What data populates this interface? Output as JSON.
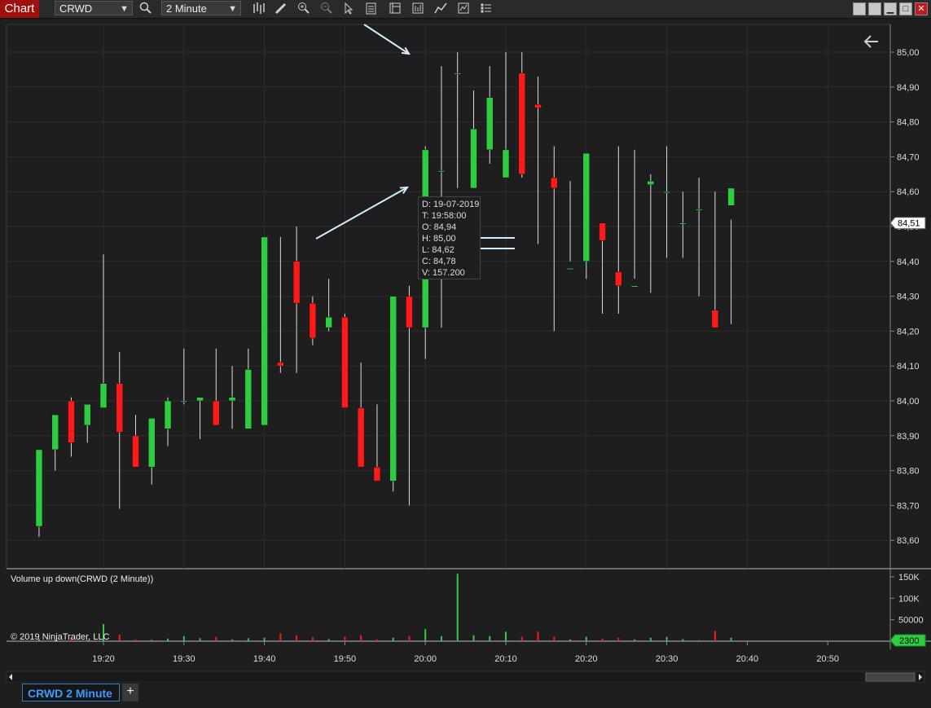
{
  "toolbar": {
    "chart_tab": "Chart",
    "instrument": "CRWD",
    "interval": "2 Minute",
    "icons": [
      "search-icon",
      "bar-type-icon",
      "drawing-tool-icon",
      "zoom-in-icon",
      "zoom-out-icon",
      "pointer-icon",
      "data-box-icon",
      "properties-icon",
      "chart-trader-icon",
      "strategies-icon",
      "indicators-icon",
      "list-icon"
    ],
    "window_buttons": [
      "minimize",
      "restore",
      "maximize",
      "close"
    ]
  },
  "price_panel": {
    "y_ticks": [
      "85,00",
      "84,90",
      "84,80",
      "84,70",
      "84,60",
      "84,50",
      "84,40",
      "84,30",
      "84,20",
      "84,10",
      "84,00",
      "83,90",
      "83,80",
      "83,70",
      "83,60"
    ],
    "current_price_label": "84,51"
  },
  "tooltip": {
    "date": "D:  19-07-2019",
    "time": "T:  19:58:00",
    "open": "O: 84,94",
    "high": "H:  85,00",
    "low": "L:  84,62",
    "close": "C:  84,78",
    "volume": "V:  157.200"
  },
  "volume_panel": {
    "title": "Volume up down(CRWD (2 Minute))",
    "y_ticks": [
      "150K",
      "100K",
      "50000"
    ],
    "current_volume_label": "2300",
    "copyright": "© 2019 NinjaTrader, LLC"
  },
  "x_axis": {
    "ticks": [
      "19:20",
      "19:30",
      "19:40",
      "19:50",
      "20:00",
      "20:10",
      "20:20",
      "20:30",
      "20:40",
      "20:50"
    ]
  },
  "bottom": {
    "sheet_tab": "CRWD 2 Minute",
    "add_tab": "+"
  },
  "colors": {
    "up": "#2ecc40",
    "down": "#ff1a1a",
    "background": "#1e1e1e",
    "grid": "#333333",
    "annotation": "#cfeeff"
  },
  "chart_data": {
    "type": "candlestick",
    "x": [
      "19:12",
      "19:14",
      "19:16",
      "19:18",
      "19:20",
      "19:22",
      "19:24",
      "19:26",
      "19:28",
      "19:30",
      "19:32",
      "19:34",
      "19:36",
      "19:38",
      "19:40",
      "19:42",
      "19:44",
      "19:46",
      "19:48",
      "19:50",
      "19:52",
      "19:54",
      "19:56",
      "19:58",
      "20:00",
      "20:02",
      "20:04",
      "20:06",
      "20:08",
      "20:10",
      "20:12",
      "20:14",
      "20:16",
      "20:18",
      "20:20",
      "20:22",
      "20:24",
      "20:26",
      "20:28",
      "20:30",
      "20:32",
      "20:34",
      "20:36",
      "20:38"
    ],
    "open": [
      83.64,
      83.86,
      84.0,
      83.93,
      83.98,
      84.05,
      83.9,
      83.81,
      83.92,
      84.0,
      84.0,
      84.0,
      84.0,
      83.92,
      83.93,
      84.11,
      84.4,
      84.28,
      84.21,
      84.24,
      83.98,
      83.81,
      83.77,
      84.3,
      84.21,
      84.66,
      84.94,
      84.61,
      84.72,
      84.64,
      84.94,
      84.85,
      84.64,
      84.38,
      84.4,
      84.51,
      84.37,
      84.33,
      84.62,
      84.6,
      84.51,
      84.55,
      84.26,
      84.56,
      84.54,
      84.36
    ],
    "high": [
      83.69,
      83.87,
      84.01,
      83.95,
      84.42,
      84.14,
      83.96,
      83.87,
      84.01,
      84.15,
      84.0,
      84.15,
      84.1,
      84.15,
      84.08,
      84.47,
      84.5,
      84.3,
      84.35,
      84.25,
      84.11,
      83.99,
      84.1,
      84.33,
      84.73,
      84.96,
      85.0,
      84.89,
      84.96,
      85.0,
      85.0,
      84.93,
      84.73,
      84.63,
      84.47,
      84.48,
      84.73,
      84.72,
      84.65,
      84.73,
      84.6,
      84.64,
      84.6,
      84.52
    ],
    "low": [
      83.61,
      83.8,
      83.84,
      83.88,
      83.98,
      83.69,
      83.85,
      83.76,
      83.87,
      83.99,
      83.89,
      83.93,
      83.92,
      84.05,
      84.08,
      84.08,
      84.08,
      84.16,
      84.2,
      84.18,
      83.83,
      83.81,
      83.74,
      83.7,
      84.12,
      84.21,
      84.61,
      84.61,
      84.68,
      84.72,
      84.64,
      84.45,
      84.2,
      84.4,
      84.35,
      84.25,
      84.25,
      84.35,
      84.31,
      84.41,
      84.41,
      84.3,
      84.21,
      84.22,
      84.48,
      84.3
    ],
    "close": [
      83.86,
      83.96,
      83.88,
      83.99,
      84.05,
      83.91,
      83.81,
      83.95,
      84.0,
      84.0,
      84.01,
      83.93,
      84.01,
      84.09,
      84.47,
      84.1,
      84.28,
      84.18,
      84.24,
      83.98,
      83.81,
      83.77,
      84.3,
      84.21,
      84.72,
      84.66,
      84.94,
      84.78,
      84.87,
      84.72,
      84.65,
      84.84,
      84.61,
      84.38,
      84.71,
      84.46,
      84.33,
      84.33,
      84.63,
      84.6,
      84.51,
      84.55,
      84.21,
      84.61,
      84.57,
      84.45
    ],
    "volume": [
      5000,
      4000,
      8000,
      3000,
      40000,
      15000,
      4000,
      3000,
      6000,
      12000,
      7000,
      10000,
      4000,
      7000,
      8000,
      18000,
      14000,
      9000,
      5000,
      10000,
      14000,
      4000,
      8000,
      12000,
      28000,
      12000,
      157200,
      14000,
      12000,
      22000,
      10000,
      22000,
      10000,
      4000,
      10000,
      6000,
      8000,
      4000,
      8000,
      10000,
      5000,
      2000,
      24000,
      8000,
      16000,
      2300
    ],
    "ylim": [
      83.55,
      85.05
    ],
    "vol_ylim": [
      0,
      160000
    ]
  }
}
